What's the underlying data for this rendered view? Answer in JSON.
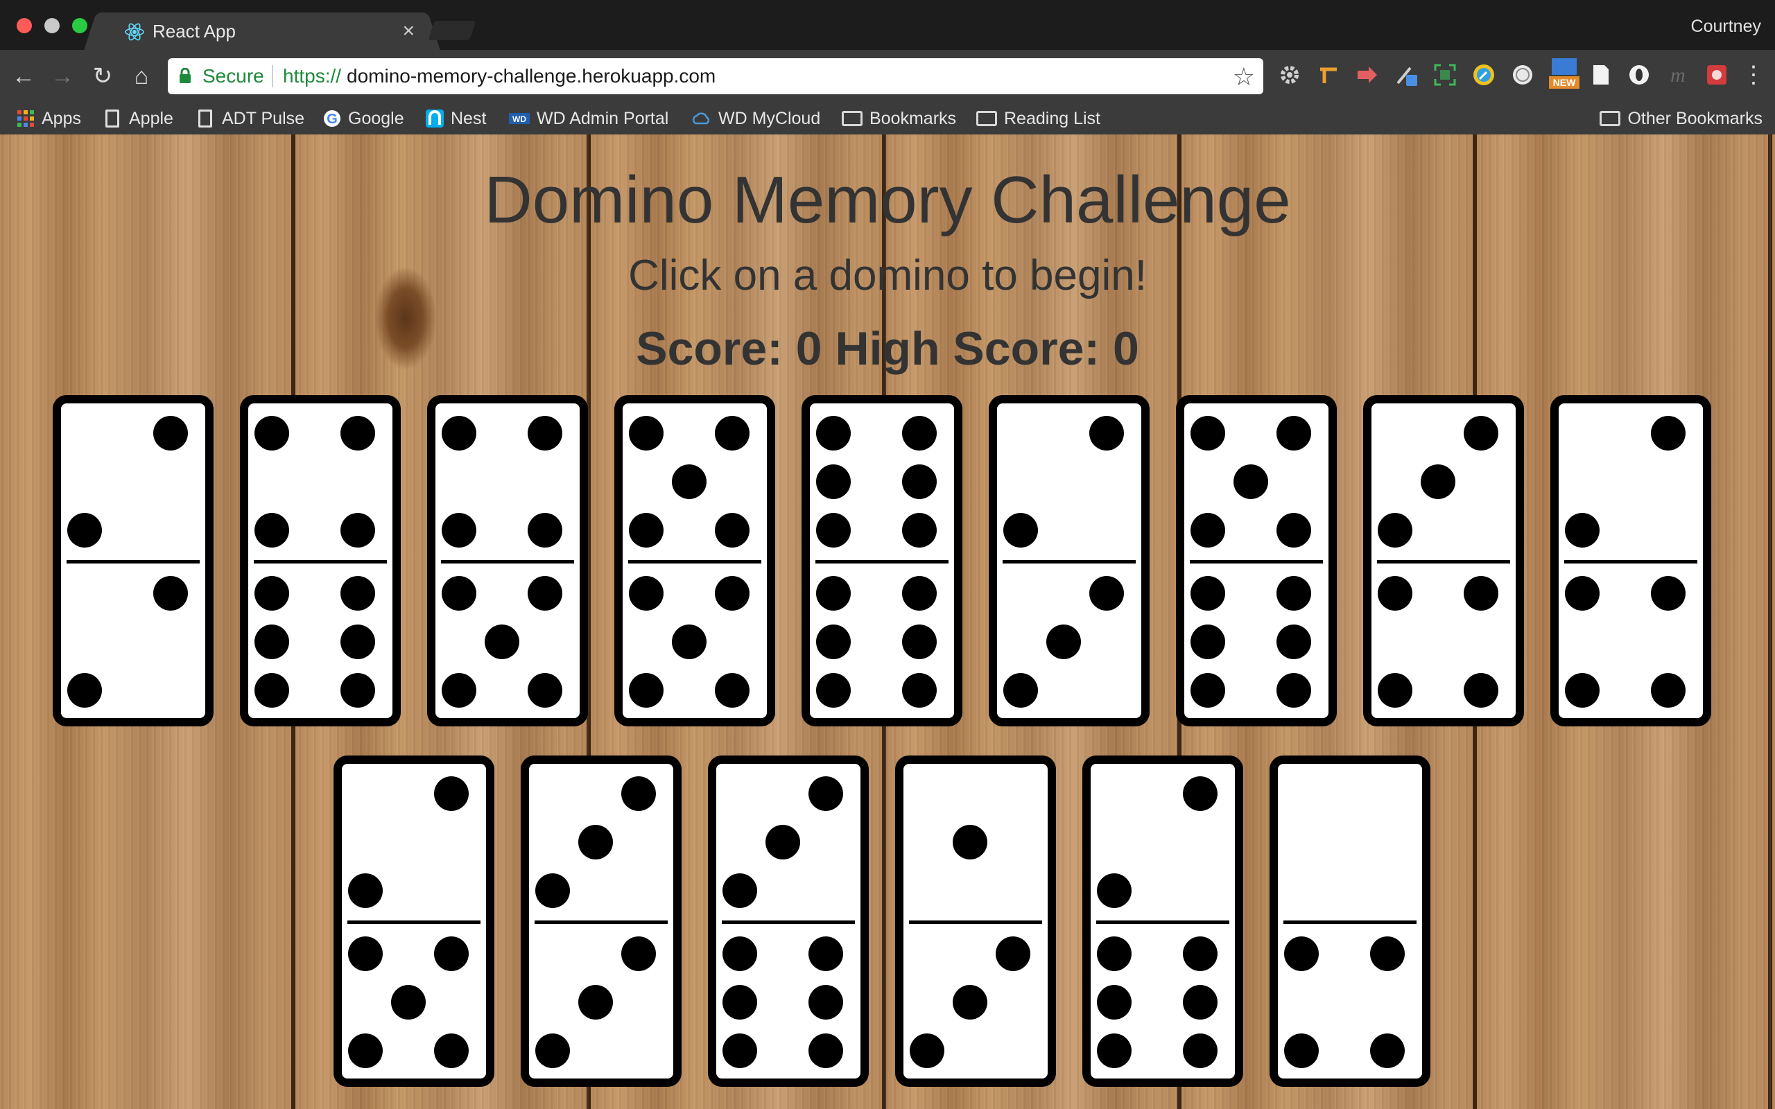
{
  "browser": {
    "tab_title": "React App",
    "tab_close": "×",
    "profile": "Courtney",
    "secure_label": "Secure",
    "url_scheme": "https://",
    "url_host": "domino-memory-challenge.herokuapp.com",
    "icons": [
      "back-icon",
      "forward-icon",
      "reload-icon",
      "home-icon",
      "lock-icon",
      "star-icon",
      "menu-icon"
    ]
  },
  "bookmarks": {
    "left": [
      {
        "label": "Apps",
        "icon": "apps-grid-icon"
      },
      {
        "label": "Apple",
        "icon": "page-icon"
      },
      {
        "label": "ADT Pulse",
        "icon": "page-icon"
      },
      {
        "label": "Google",
        "icon": "google-icon"
      },
      {
        "label": "Nest",
        "icon": "nest-icon"
      },
      {
        "label": "WD Admin Portal",
        "icon": "wd-icon"
      },
      {
        "label": "WD MyCloud",
        "icon": "cloud-icon"
      },
      {
        "label": "Bookmarks",
        "icon": "folder-icon"
      },
      {
        "label": "Reading List",
        "icon": "folder-icon"
      }
    ],
    "right": {
      "label": "Other Bookmarks",
      "icon": "folder-icon"
    }
  },
  "game": {
    "title": "Domino Memory Challenge",
    "instruction": "Click on a domino to begin!",
    "score_line": "Score: 0 High Score: 0",
    "score": 0,
    "high_score": 0,
    "dominoes": [
      [
        2,
        2
      ],
      [
        4,
        6
      ],
      [
        4,
        5
      ],
      [
        5,
        5
      ],
      [
        6,
        6
      ],
      [
        2,
        3
      ],
      [
        5,
        6
      ],
      [
        3,
        4
      ],
      [
        2,
        4
      ],
      [
        2,
        5
      ],
      [
        3,
        3
      ],
      [
        3,
        6
      ],
      [
        1,
        3
      ],
      [
        2,
        6
      ],
      [
        0,
        4
      ]
    ]
  }
}
